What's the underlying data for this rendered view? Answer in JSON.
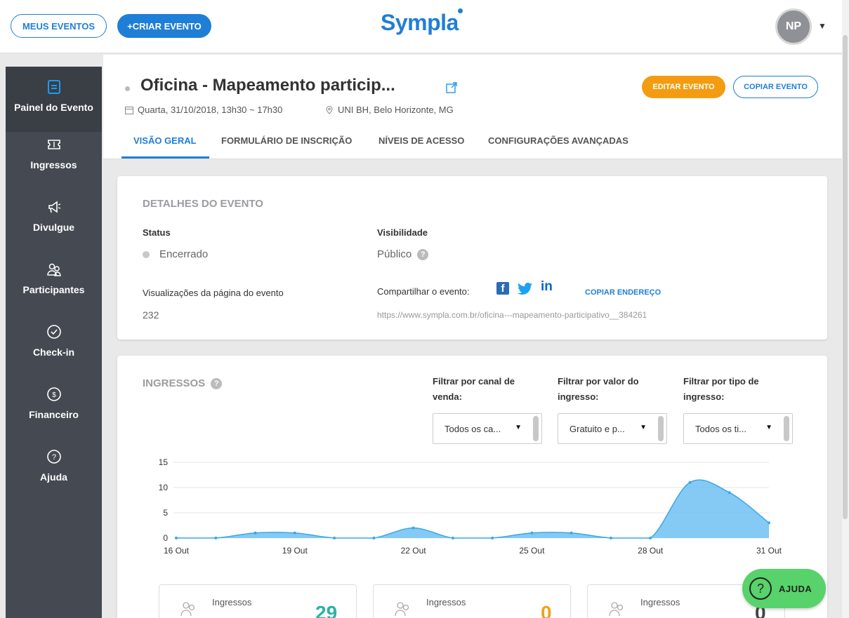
{
  "topbar": {
    "my_events_label": "MEUS EVENTOS",
    "create_event_label": "+CRIAR EVENTO",
    "logo_text": "Sympla",
    "avatar_initials": "NP"
  },
  "sidebar": {
    "items": [
      {
        "label": "Painel do Evento",
        "icon": "dashboard-icon"
      },
      {
        "label": "Ingressos",
        "icon": "ticket-icon"
      },
      {
        "label": "Divulgue",
        "icon": "megaphone-icon"
      },
      {
        "label": "Participantes",
        "icon": "users-icon"
      },
      {
        "label": "Check-in",
        "icon": "check-icon"
      },
      {
        "label": "Financeiro",
        "icon": "money-icon"
      },
      {
        "label": "Ajuda",
        "icon": "help-icon"
      }
    ]
  },
  "event": {
    "title": "Oficina - Mapeamento particip...",
    "date": "Quarta, 31/10/2018, 13h30 ~ 17h30",
    "location": "UNI BH, Belo Horizonte, MG",
    "edit_label": "EDITAR EVENTO",
    "copy_label": "COPIAR EVENTO",
    "tabs": [
      "VISÃO GERAL",
      "FORMULÁRIO DE INSCRIÇÃO",
      "NÍVEIS DE ACESSO",
      "CONFIGURAÇÕES AVANÇADAS"
    ]
  },
  "details": {
    "section_title": "DETALHES DO EVENTO",
    "status_label": "Status",
    "status_value": "Encerrado",
    "visibility_label": "Visibilidade",
    "visibility_value": "Público",
    "views_label": "Visualizações da página do evento",
    "views_value": "232",
    "share_label": "Compartilhar o evento:",
    "copy_address_label": "COPIAR ENDEREÇO",
    "url": "https://www.sympla.com.br/oficina---mapeamento-participativo__384261"
  },
  "tickets": {
    "section_title": "INGRESSOS",
    "filters": [
      {
        "label": "Filtrar por canal de venda:",
        "value": "Todos os ca..."
      },
      {
        "label": "Filtrar por valor do ingresso:",
        "value": "Gratuito e p..."
      },
      {
        "label": "Filtrar por tipo de ingresso:",
        "value": "Todos os ti..."
      }
    ],
    "stats": [
      {
        "label": "Ingressos",
        "value": "29",
        "color": "#2bb3a3"
      },
      {
        "label": "Ingressos",
        "value": "0",
        "color": "#f0a21a"
      },
      {
        "label": "Ingressos",
        "value": "0",
        "color": "#444444"
      }
    ]
  },
  "chart_data": {
    "type": "area",
    "x": [
      "16 Out",
      "17 Out",
      "18 Out",
      "19 Out",
      "20 Out",
      "21 Out",
      "22 Out",
      "23 Out",
      "24 Out",
      "25 Out",
      "26 Out",
      "27 Out",
      "28 Out",
      "29 Out",
      "30 Out",
      "31 Out"
    ],
    "x_tick_labels": [
      "16 Out",
      "19 Out",
      "22 Out",
      "25 Out",
      "28 Out",
      "31 Out"
    ],
    "values": [
      0,
      0,
      1,
      1,
      0,
      0,
      2,
      0,
      0,
      1,
      1,
      0,
      0,
      11,
      9,
      3
    ],
    "ylim": [
      0,
      15
    ],
    "y_ticks": [
      0,
      5,
      10,
      15
    ],
    "grid": true,
    "color": "#5bb8f0"
  },
  "help": {
    "label": "AJUDA"
  }
}
